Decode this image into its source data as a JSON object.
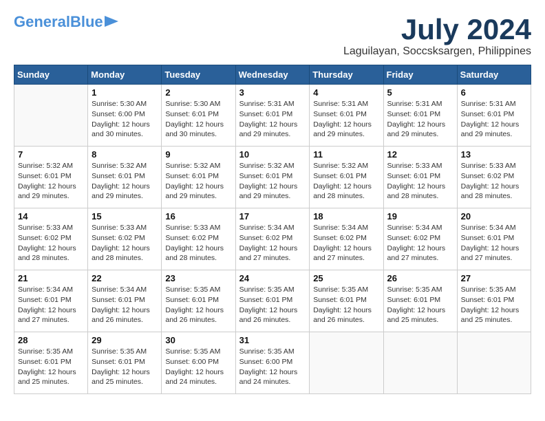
{
  "logo": {
    "line1": "General",
    "line2": "Blue"
  },
  "title": {
    "month_year": "July 2024",
    "location": "Laguilayan, Soccsksargen, Philippines"
  },
  "headers": [
    "Sunday",
    "Monday",
    "Tuesday",
    "Wednesday",
    "Thursday",
    "Friday",
    "Saturday"
  ],
  "weeks": [
    [
      {
        "day": "",
        "text": ""
      },
      {
        "day": "1",
        "text": "Sunrise: 5:30 AM\nSunset: 6:00 PM\nDaylight: 12 hours\nand 30 minutes."
      },
      {
        "day": "2",
        "text": "Sunrise: 5:30 AM\nSunset: 6:01 PM\nDaylight: 12 hours\nand 30 minutes."
      },
      {
        "day": "3",
        "text": "Sunrise: 5:31 AM\nSunset: 6:01 PM\nDaylight: 12 hours\nand 29 minutes."
      },
      {
        "day": "4",
        "text": "Sunrise: 5:31 AM\nSunset: 6:01 PM\nDaylight: 12 hours\nand 29 minutes."
      },
      {
        "day": "5",
        "text": "Sunrise: 5:31 AM\nSunset: 6:01 PM\nDaylight: 12 hours\nand 29 minutes."
      },
      {
        "day": "6",
        "text": "Sunrise: 5:31 AM\nSunset: 6:01 PM\nDaylight: 12 hours\nand 29 minutes."
      }
    ],
    [
      {
        "day": "7",
        "text": "Sunrise: 5:32 AM\nSunset: 6:01 PM\nDaylight: 12 hours\nand 29 minutes."
      },
      {
        "day": "8",
        "text": "Sunrise: 5:32 AM\nSunset: 6:01 PM\nDaylight: 12 hours\nand 29 minutes."
      },
      {
        "day": "9",
        "text": "Sunrise: 5:32 AM\nSunset: 6:01 PM\nDaylight: 12 hours\nand 29 minutes."
      },
      {
        "day": "10",
        "text": "Sunrise: 5:32 AM\nSunset: 6:01 PM\nDaylight: 12 hours\nand 29 minutes."
      },
      {
        "day": "11",
        "text": "Sunrise: 5:32 AM\nSunset: 6:01 PM\nDaylight: 12 hours\nand 28 minutes."
      },
      {
        "day": "12",
        "text": "Sunrise: 5:33 AM\nSunset: 6:01 PM\nDaylight: 12 hours\nand 28 minutes."
      },
      {
        "day": "13",
        "text": "Sunrise: 5:33 AM\nSunset: 6:02 PM\nDaylight: 12 hours\nand 28 minutes."
      }
    ],
    [
      {
        "day": "14",
        "text": "Sunrise: 5:33 AM\nSunset: 6:02 PM\nDaylight: 12 hours\nand 28 minutes."
      },
      {
        "day": "15",
        "text": "Sunrise: 5:33 AM\nSunset: 6:02 PM\nDaylight: 12 hours\nand 28 minutes."
      },
      {
        "day": "16",
        "text": "Sunrise: 5:33 AM\nSunset: 6:02 PM\nDaylight: 12 hours\nand 28 minutes."
      },
      {
        "day": "17",
        "text": "Sunrise: 5:34 AM\nSunset: 6:02 PM\nDaylight: 12 hours\nand 27 minutes."
      },
      {
        "day": "18",
        "text": "Sunrise: 5:34 AM\nSunset: 6:02 PM\nDaylight: 12 hours\nand 27 minutes."
      },
      {
        "day": "19",
        "text": "Sunrise: 5:34 AM\nSunset: 6:02 PM\nDaylight: 12 hours\nand 27 minutes."
      },
      {
        "day": "20",
        "text": "Sunrise: 5:34 AM\nSunset: 6:01 PM\nDaylight: 12 hours\nand 27 minutes."
      }
    ],
    [
      {
        "day": "21",
        "text": "Sunrise: 5:34 AM\nSunset: 6:01 PM\nDaylight: 12 hours\nand 27 minutes."
      },
      {
        "day": "22",
        "text": "Sunrise: 5:34 AM\nSunset: 6:01 PM\nDaylight: 12 hours\nand 26 minutes."
      },
      {
        "day": "23",
        "text": "Sunrise: 5:35 AM\nSunset: 6:01 PM\nDaylight: 12 hours\nand 26 minutes."
      },
      {
        "day": "24",
        "text": "Sunrise: 5:35 AM\nSunset: 6:01 PM\nDaylight: 12 hours\nand 26 minutes."
      },
      {
        "day": "25",
        "text": "Sunrise: 5:35 AM\nSunset: 6:01 PM\nDaylight: 12 hours\nand 26 minutes."
      },
      {
        "day": "26",
        "text": "Sunrise: 5:35 AM\nSunset: 6:01 PM\nDaylight: 12 hours\nand 25 minutes."
      },
      {
        "day": "27",
        "text": "Sunrise: 5:35 AM\nSunset: 6:01 PM\nDaylight: 12 hours\nand 25 minutes."
      }
    ],
    [
      {
        "day": "28",
        "text": "Sunrise: 5:35 AM\nSunset: 6:01 PM\nDaylight: 12 hours\nand 25 minutes."
      },
      {
        "day": "29",
        "text": "Sunrise: 5:35 AM\nSunset: 6:01 PM\nDaylight: 12 hours\nand 25 minutes."
      },
      {
        "day": "30",
        "text": "Sunrise: 5:35 AM\nSunset: 6:00 PM\nDaylight: 12 hours\nand 24 minutes."
      },
      {
        "day": "31",
        "text": "Sunrise: 5:35 AM\nSunset: 6:00 PM\nDaylight: 12 hours\nand 24 minutes."
      },
      {
        "day": "",
        "text": ""
      },
      {
        "day": "",
        "text": ""
      },
      {
        "day": "",
        "text": ""
      }
    ]
  ]
}
